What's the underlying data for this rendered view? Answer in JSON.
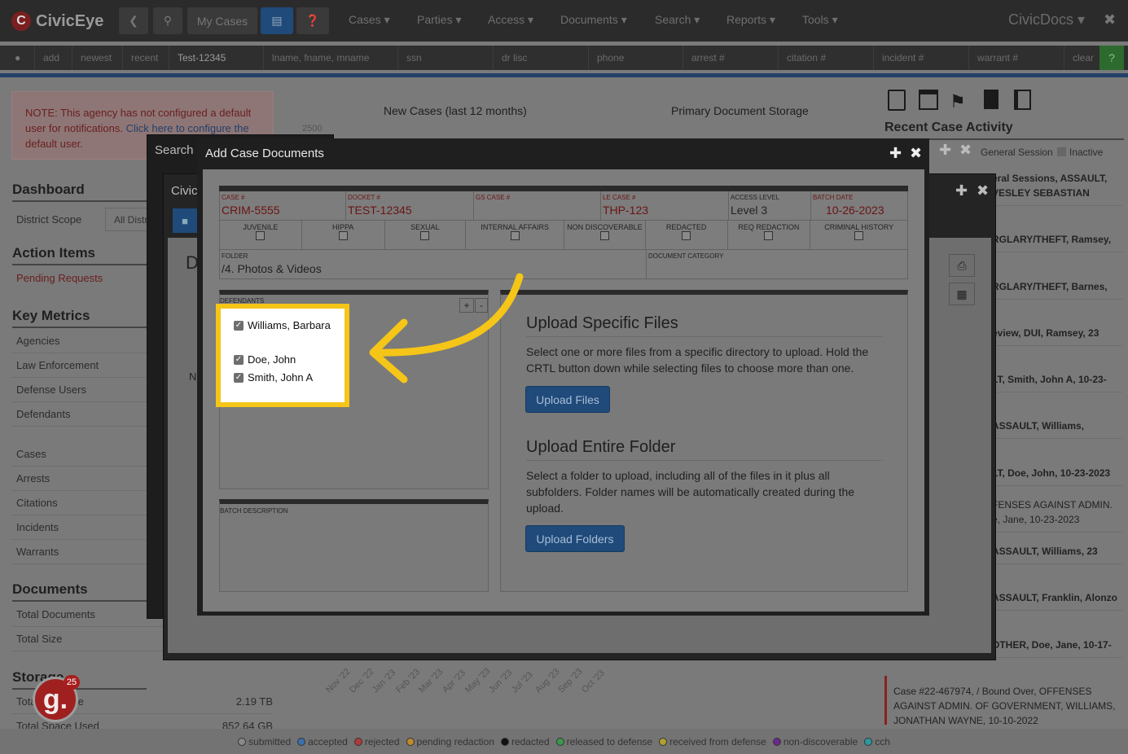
{
  "navbar": {
    "brand": "CivicEye",
    "my_cases_placeholder": "My Cases",
    "menus": [
      "Cases",
      "Parties",
      "Access",
      "Documents",
      "Search",
      "Reports",
      "Tools"
    ],
    "right_brand": "CivicDocs"
  },
  "searchbar": {
    "add": "add",
    "newest": "newest",
    "recent": "recent",
    "case_value": "Test-12345",
    "name_placeholder": "lname, fname, mname",
    "ssn_placeholder": "ssn",
    "drlisc_placeholder": "dr lisc",
    "phone_placeholder": "phone",
    "arrest_placeholder": "arrest #",
    "citation_placeholder": "citation #",
    "incident_placeholder": "incident #",
    "warrant_placeholder": "warrant #",
    "clear": "clear",
    "help": "?"
  },
  "notice": {
    "text1": "NOTE: This agency has not configured a default user for notifications. ",
    "link": "Click here to configure the",
    "text2": " default user."
  },
  "sidebar": {
    "dashboard": "Dashboard",
    "district_scope_label": "District Scope",
    "district_scope_value": "All Distr",
    "action_items": "Action Items",
    "pending_requests": "Pending Requests",
    "key_metrics": "Key Metrics",
    "metrics": [
      "Agencies",
      "Law Enforcement",
      "Defense Users",
      "Defendants",
      "Cases",
      "Arrests",
      "Citations",
      "Incidents",
      "Warrants"
    ],
    "documents": "Documents",
    "doc_items": [
      "Total Documents",
      "Total Size"
    ],
    "storage": "Storage",
    "storage_rows": [
      {
        "label": "Total Available",
        "value": "2.19 TB"
      },
      {
        "label": "Total Space Used",
        "value": "852.64 GB"
      }
    ]
  },
  "charts": {
    "new_cases_title": "New Cases (last 12 months)",
    "storage_title": "Primary Document Storage",
    "y_tick": "2500",
    "months": [
      "Nov '22",
      "Dec '22",
      "Jan '23",
      "Feb '23",
      "Mar '23",
      "Apr '23",
      "May '23",
      "Jun '23",
      "Jul '23",
      "Aug '23",
      "Sep '23",
      "Oct '23"
    ]
  },
  "recent": {
    "title": "Recent Case Activity",
    "filter_general": "General Session",
    "filter_inactive": "Inactive",
    "items": [
      "eral Sessions, ASSAULT, VESLEY SEBASTIAN",
      "RGLARY/THEFT, Ramsey,",
      "RGLARY/THEFT, Barnes,",
      "eview, DUI, Ramsey, 23",
      "LT, Smith, John A, 10-23-",
      "ASSAULT, Williams,",
      "LT, Doe, John, 10-23-2023",
      "FENSES AGAINST ADMIN. e, Jane, 10-23-2023",
      "ASSAULT, Williams, 23",
      "ASSAULT, Franklin, Alonzo",
      "OTHER, Doe, Jane, 10-17-",
      "Case #22-467974, / Bound Over, OFFENSES AGAINST ADMIN. OF GOVERNMENT, WILLIAMS, JONATHAN WAYNE, 10-10-2022"
    ]
  },
  "legend": [
    "submitted",
    "accepted",
    "rejected",
    "pending redaction",
    "redacted",
    "released to defense",
    "received from defense",
    "non-discoverable",
    "cch"
  ],
  "legend_colors": [
    "#8a8a8a",
    "#3a6fb0",
    "#b03a3a",
    "#c08a2a",
    "#111111",
    "#3a9a4a",
    "#b0a030",
    "#6a2a8a",
    "#2a9aa0"
  ],
  "bg_dialogs": {
    "search_title": "Search",
    "civic_title": "Civic",
    "d_letter": "D",
    "n_letter": "N"
  },
  "dialog": {
    "title": "Add Case Documents",
    "case_label": "CASE #",
    "case_value": "CRIM-5555",
    "docket_label": "DOCKET #",
    "docket_value": "TEST-12345",
    "gs_label": "GS CASE #",
    "gs_value": "",
    "le_label": "LE CASE #",
    "le_value": "THP-123",
    "access_label": "ACCESS LEVEL",
    "access_value": "Level 3",
    "batch_label": "BATCH DATE",
    "batch_value": "10-26-2023",
    "flags": [
      "JUVENILE",
      "HIPPA",
      "SEXUAL",
      "INTERNAL AFFAIRS",
      "NON DISCOVERABLE",
      "REDACTED",
      "REQ REDACTION",
      "CRIMINAL HISTORY"
    ],
    "folder_label": "FOLDER",
    "folder_value": "/4. Photos & Videos",
    "category_label": "DOCUMENT CATEGORY",
    "defendants_label": "DEFENDANTS",
    "defendants": [
      "Williams, Barbara",
      "Doe, John",
      "Smith, John A"
    ],
    "batch_desc_label": "BATCH DESCRIPTION",
    "upload_files_title": "Upload Specific Files",
    "upload_files_text": "Select one or more files from a specific directory to upload. Hold the CRTL button down while selecting files to choose more than one.",
    "upload_files_btn": "Upload Files",
    "upload_folder_title": "Upload Entire Folder",
    "upload_folder_text": "Select a folder to upload, including all of the files in it plus all subfolders. Folder names will be automatically created during the upload.",
    "upload_folder_btn": "Upload Folders"
  },
  "badge": {
    "count": "25",
    "letter": "g."
  }
}
